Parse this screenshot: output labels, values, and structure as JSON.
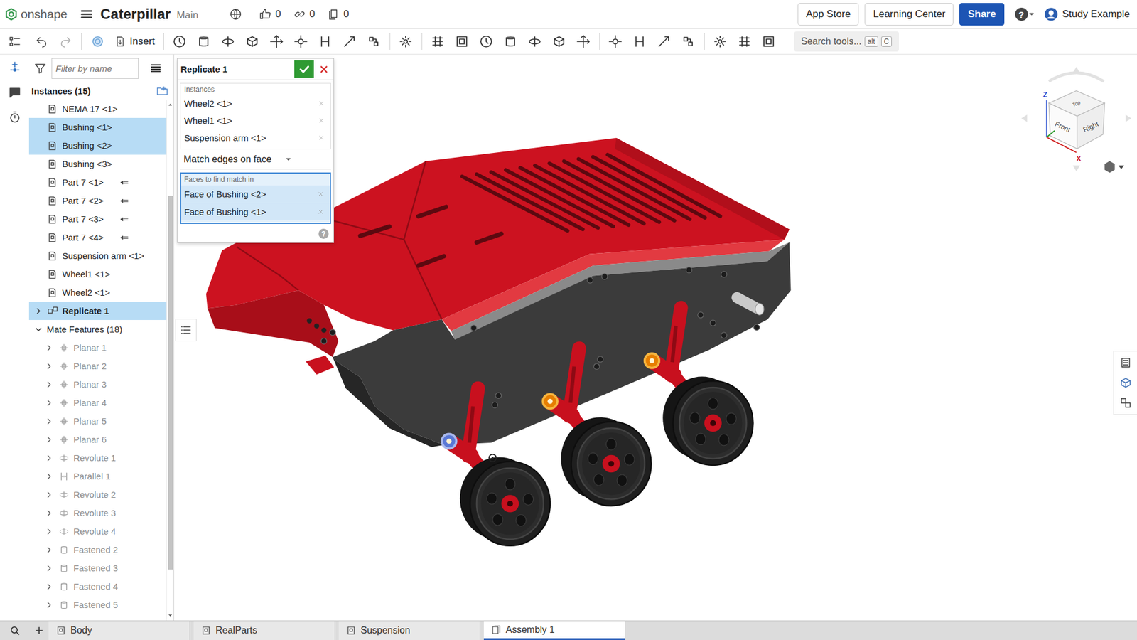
{
  "header": {
    "logo": "onshape",
    "document": "Caterpillar",
    "branch": "Main",
    "counters": [
      {
        "kind": "likes",
        "value": "0"
      },
      {
        "kind": "links",
        "value": "0"
      },
      {
        "kind": "copies",
        "value": "0"
      }
    ],
    "buttons": [
      {
        "label": "App Store",
        "primary": false
      },
      {
        "label": "Learning Center",
        "primary": false
      },
      {
        "label": "Share",
        "primary": true
      }
    ],
    "help": "?",
    "user": "Study Example"
  },
  "toolbar": {
    "insert": "Insert",
    "search": "Search tools...",
    "keys": [
      "alt",
      "C"
    ]
  },
  "panel": {
    "filter_placeholder": "Filter by name",
    "title": "Instances (15)",
    "items": [
      {
        "label": "NEMA 17 <1>",
        "kind": "part",
        "selected": false,
        "linked": false
      },
      {
        "label": "Bushing <1>",
        "kind": "part",
        "selected": true,
        "linked": false
      },
      {
        "label": "Bushing <2>",
        "kind": "part",
        "selected": true,
        "linked": false
      },
      {
        "label": "Bushing <3>",
        "kind": "part",
        "selected": false,
        "linked": false
      },
      {
        "label": "Part 7 <1>",
        "kind": "part",
        "selected": false,
        "linked": true
      },
      {
        "label": "Part 7 <2>",
        "kind": "part",
        "selected": false,
        "linked": true
      },
      {
        "label": "Part 7 <3>",
        "kind": "part",
        "selected": false,
        "linked": true
      },
      {
        "label": "Part 7 <4>",
        "kind": "part",
        "selected": false,
        "linked": true
      },
      {
        "label": "Suspension arm <1>",
        "kind": "part",
        "selected": false,
        "linked": false
      },
      {
        "label": "Wheel1 <1>",
        "kind": "part",
        "selected": false,
        "linked": false
      },
      {
        "label": "Wheel2 <1>",
        "kind": "part",
        "selected": false,
        "linked": false
      },
      {
        "label": "Replicate 1",
        "kind": "replicate",
        "selected": true,
        "linked": false,
        "expanded": false
      }
    ],
    "mates": {
      "title": "Mate Features (18)",
      "expanded": true,
      "items": [
        {
          "label": "Planar 1",
          "kind": "planar",
          "disabled": true,
          "expanded": false
        },
        {
          "label": "Planar 2",
          "kind": "planar",
          "disabled": true,
          "expanded": false
        },
        {
          "label": "Planar 3",
          "kind": "planar",
          "disabled": true,
          "expanded": false
        },
        {
          "label": "Planar 4",
          "kind": "planar",
          "disabled": true,
          "expanded": false
        },
        {
          "label": "Planar 5",
          "kind": "planar",
          "disabled": true,
          "expanded": false
        },
        {
          "label": "Planar 6",
          "kind": "planar",
          "disabled": true,
          "expanded": false
        },
        {
          "label": "Revolute 1",
          "kind": "revolute",
          "disabled": true,
          "expanded": false
        },
        {
          "label": "Parallel 1",
          "kind": "parallel",
          "disabled": true,
          "expanded": false
        },
        {
          "label": "Revolute 2",
          "kind": "revolute",
          "disabled": true,
          "expanded": false
        },
        {
          "label": "Revolute 3",
          "kind": "revolute",
          "disabled": true,
          "expanded": false
        },
        {
          "label": "Revolute 4",
          "kind": "revolute",
          "disabled": true,
          "expanded": false
        },
        {
          "label": "Fastened 2",
          "kind": "fastened",
          "disabled": true,
          "expanded": false
        },
        {
          "label": "Fastened 3",
          "kind": "fastened",
          "disabled": true,
          "expanded": false
        },
        {
          "label": "Fastened 4",
          "kind": "fastened",
          "disabled": true,
          "expanded": false
        },
        {
          "label": "Fastened 5",
          "kind": "fastened",
          "disabled": true,
          "expanded": false
        }
      ]
    }
  },
  "dialog": {
    "title": "Replicate 1",
    "instances_label": "Instances",
    "instances": [
      "Wheel2 <1>",
      "Wheel1 <1>",
      "Suspension arm <1>"
    ],
    "mode": "Match edges on face",
    "faces_label": "Faces to find match in",
    "faces_active": true,
    "faces": [
      "Face of Bushing <2>",
      "Face of Bushing <1>"
    ],
    "help": "?"
  },
  "viewcube": {
    "top": "Top",
    "front": "Front",
    "right": "Right",
    "axes": [
      "Z",
      "X"
    ]
  },
  "tabs": [
    {
      "label": "Body",
      "kind": "partstudio",
      "selected": false
    },
    {
      "label": "RealParts",
      "kind": "partstudio",
      "selected": false
    },
    {
      "label": "Suspension",
      "kind": "partstudio",
      "selected": false
    },
    {
      "label": "Assembly 1",
      "kind": "assembly",
      "selected": true
    }
  ]
}
